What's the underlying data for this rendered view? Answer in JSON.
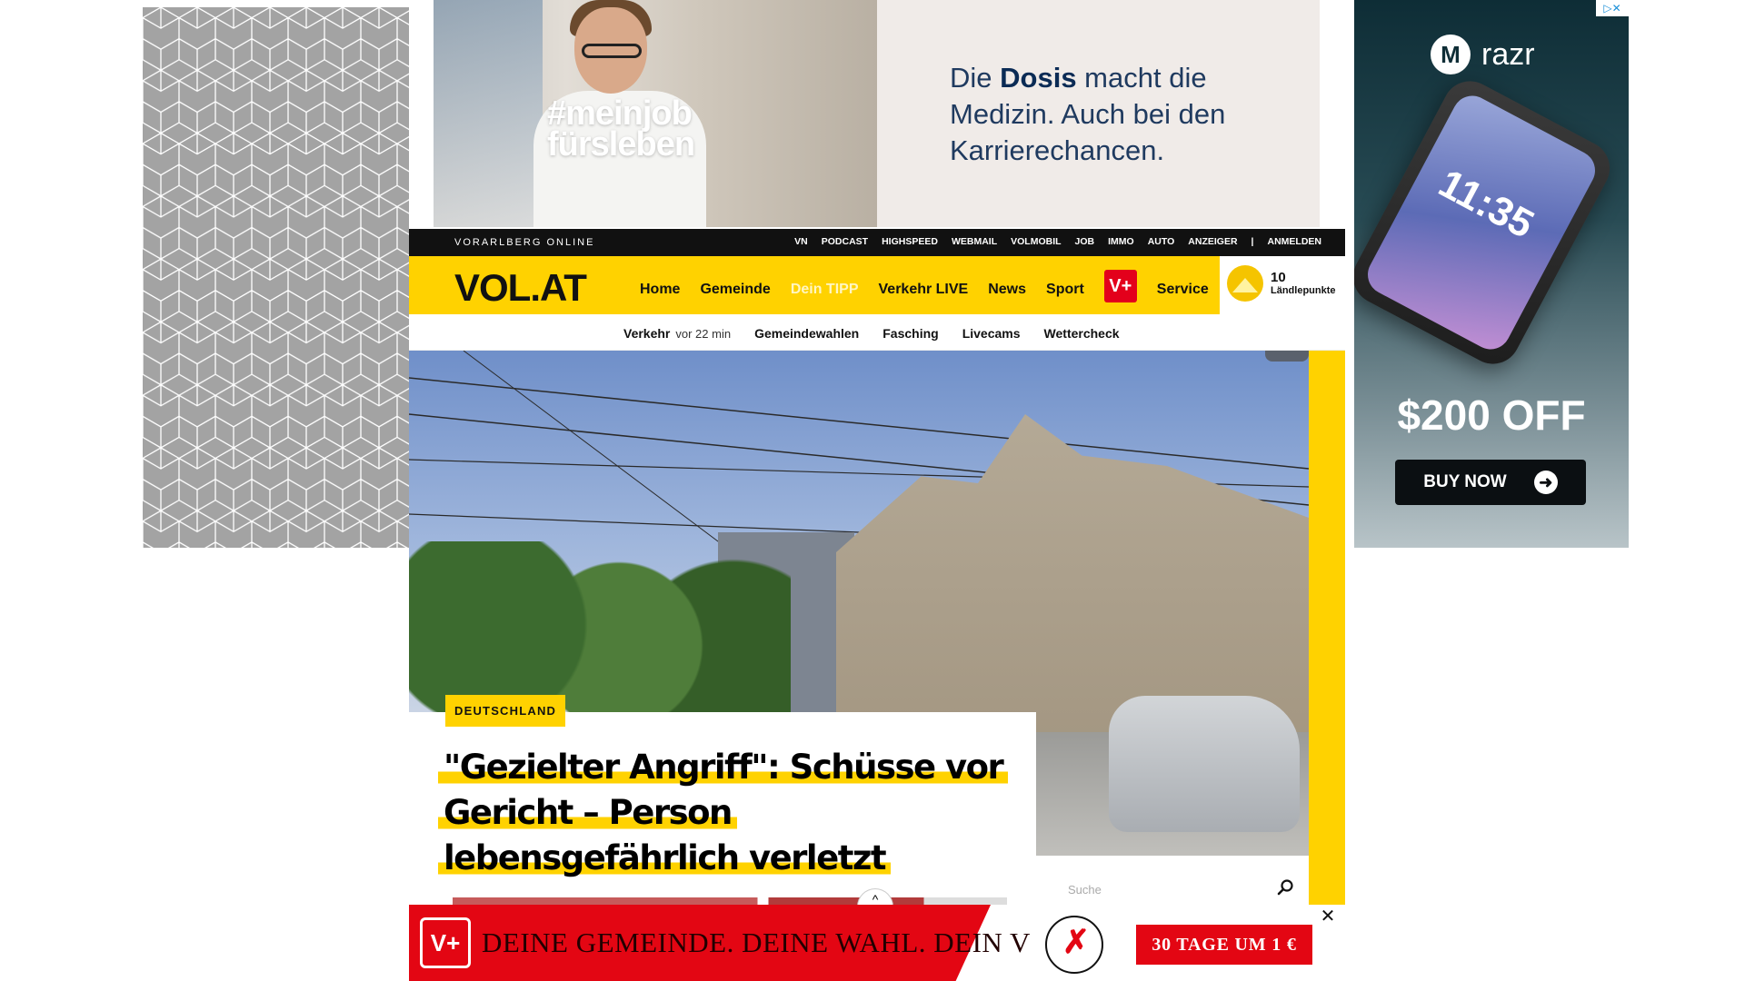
{
  "top_ad": {
    "hashtag": "#meinjob fürsleben",
    "headline_before": "Die ",
    "headline_bold": "Dosis",
    "headline_after": " macht die Medizin. Auch bei den Karrierechancen."
  },
  "right_ad": {
    "brand": "razr",
    "phone_time": "11:35",
    "offer": "$200 OFF",
    "button": "BUY NOW",
    "adchoices": "▷✕"
  },
  "topbar": {
    "site_name": "VORARLBERG ONLINE",
    "links": [
      "VN",
      "PODCAST",
      "HIGHSPEED",
      "WEBMAIL",
      "VOLMOBIL",
      "JOB",
      "IMMO",
      "AUTO",
      "ANZEIGER",
      "ANMELDEN"
    ],
    "separator": "|"
  },
  "nav": {
    "logo": "VOL.AT",
    "items": [
      "Home",
      "Gemeinde",
      "Dein TIPP",
      "Verkehr LIVE",
      "News",
      "Sport"
    ],
    "vplus": "V+",
    "service": "Service",
    "points_value": "10",
    "points_label": "Ländlepunkte"
  },
  "subnav": {
    "traffic": "Verkehr",
    "traffic_time": "vor 22 min",
    "items": [
      "Gemeindewahlen",
      "Fasching",
      "Livecams",
      "Wettercheck"
    ]
  },
  "article": {
    "category": "DEUTSCHLAND",
    "headline": "\"Gezielter Angriff\": Schüsse vor Gericht – Person lebensgefährlich verletzt",
    "scroll_up": "^"
  },
  "search": {
    "placeholder": "Suche"
  },
  "bottom_ad": {
    "vplus": "V+",
    "slogan": "DEINE GEMEINDE. DEINE WAHL. DEIN V",
    "ballot_mark": "✗",
    "cta": "30 TAGE UM 1 €",
    "close": "✕"
  },
  "colors": {
    "brand_yellow": "#ffd200",
    "brand_red": "#e3001b",
    "topbar_black": "#111111"
  }
}
